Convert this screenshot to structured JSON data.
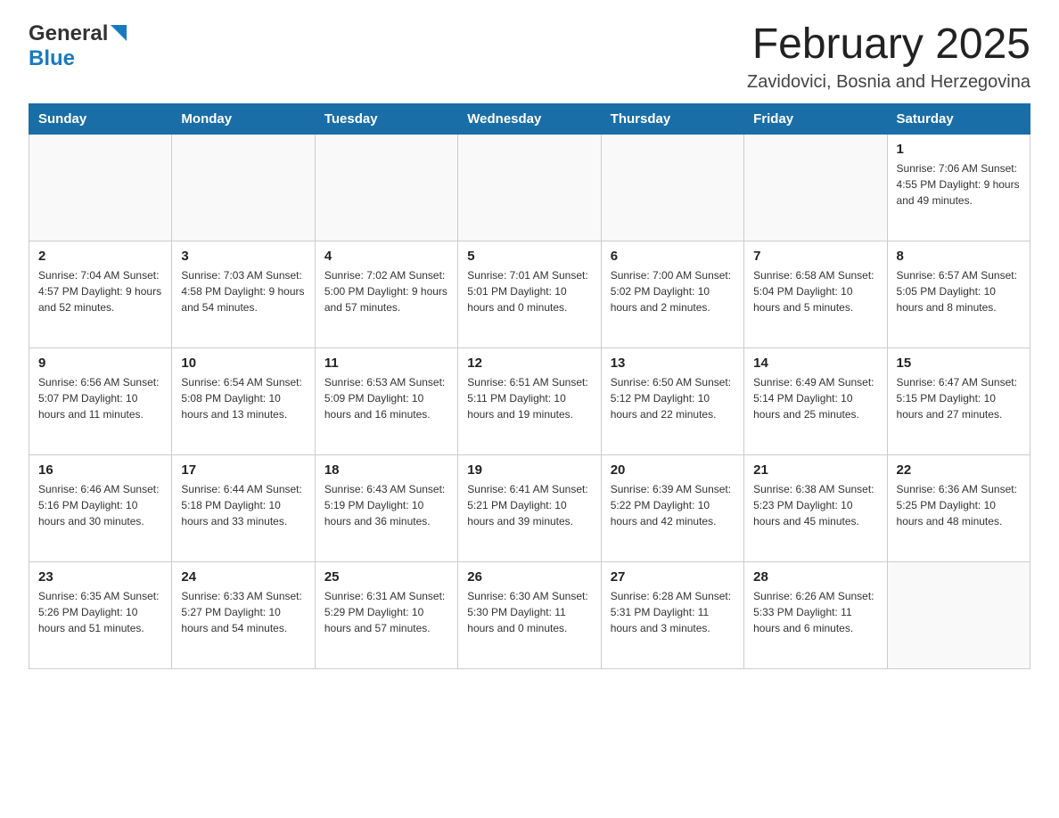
{
  "header": {
    "logo": {
      "general": "General",
      "blue": "Blue",
      "aria": "GeneralBlue logo"
    },
    "title": "February 2025",
    "subtitle": "Zavidovici, Bosnia and Herzegovina"
  },
  "weekdays": [
    "Sunday",
    "Monday",
    "Tuesday",
    "Wednesday",
    "Thursday",
    "Friday",
    "Saturday"
  ],
  "weeks": [
    [
      {
        "day": "",
        "info": ""
      },
      {
        "day": "",
        "info": ""
      },
      {
        "day": "",
        "info": ""
      },
      {
        "day": "",
        "info": ""
      },
      {
        "day": "",
        "info": ""
      },
      {
        "day": "",
        "info": ""
      },
      {
        "day": "1",
        "info": "Sunrise: 7:06 AM\nSunset: 4:55 PM\nDaylight: 9 hours and 49 minutes."
      }
    ],
    [
      {
        "day": "2",
        "info": "Sunrise: 7:04 AM\nSunset: 4:57 PM\nDaylight: 9 hours and 52 minutes."
      },
      {
        "day": "3",
        "info": "Sunrise: 7:03 AM\nSunset: 4:58 PM\nDaylight: 9 hours and 54 minutes."
      },
      {
        "day": "4",
        "info": "Sunrise: 7:02 AM\nSunset: 5:00 PM\nDaylight: 9 hours and 57 minutes."
      },
      {
        "day": "5",
        "info": "Sunrise: 7:01 AM\nSunset: 5:01 PM\nDaylight: 10 hours and 0 minutes."
      },
      {
        "day": "6",
        "info": "Sunrise: 7:00 AM\nSunset: 5:02 PM\nDaylight: 10 hours and 2 minutes."
      },
      {
        "day": "7",
        "info": "Sunrise: 6:58 AM\nSunset: 5:04 PM\nDaylight: 10 hours and 5 minutes."
      },
      {
        "day": "8",
        "info": "Sunrise: 6:57 AM\nSunset: 5:05 PM\nDaylight: 10 hours and 8 minutes."
      }
    ],
    [
      {
        "day": "9",
        "info": "Sunrise: 6:56 AM\nSunset: 5:07 PM\nDaylight: 10 hours and 11 minutes."
      },
      {
        "day": "10",
        "info": "Sunrise: 6:54 AM\nSunset: 5:08 PM\nDaylight: 10 hours and 13 minutes."
      },
      {
        "day": "11",
        "info": "Sunrise: 6:53 AM\nSunset: 5:09 PM\nDaylight: 10 hours and 16 minutes."
      },
      {
        "day": "12",
        "info": "Sunrise: 6:51 AM\nSunset: 5:11 PM\nDaylight: 10 hours and 19 minutes."
      },
      {
        "day": "13",
        "info": "Sunrise: 6:50 AM\nSunset: 5:12 PM\nDaylight: 10 hours and 22 minutes."
      },
      {
        "day": "14",
        "info": "Sunrise: 6:49 AM\nSunset: 5:14 PM\nDaylight: 10 hours and 25 minutes."
      },
      {
        "day": "15",
        "info": "Sunrise: 6:47 AM\nSunset: 5:15 PM\nDaylight: 10 hours and 27 minutes."
      }
    ],
    [
      {
        "day": "16",
        "info": "Sunrise: 6:46 AM\nSunset: 5:16 PM\nDaylight: 10 hours and 30 minutes."
      },
      {
        "day": "17",
        "info": "Sunrise: 6:44 AM\nSunset: 5:18 PM\nDaylight: 10 hours and 33 minutes."
      },
      {
        "day": "18",
        "info": "Sunrise: 6:43 AM\nSunset: 5:19 PM\nDaylight: 10 hours and 36 minutes."
      },
      {
        "day": "19",
        "info": "Sunrise: 6:41 AM\nSunset: 5:21 PM\nDaylight: 10 hours and 39 minutes."
      },
      {
        "day": "20",
        "info": "Sunrise: 6:39 AM\nSunset: 5:22 PM\nDaylight: 10 hours and 42 minutes."
      },
      {
        "day": "21",
        "info": "Sunrise: 6:38 AM\nSunset: 5:23 PM\nDaylight: 10 hours and 45 minutes."
      },
      {
        "day": "22",
        "info": "Sunrise: 6:36 AM\nSunset: 5:25 PM\nDaylight: 10 hours and 48 minutes."
      }
    ],
    [
      {
        "day": "23",
        "info": "Sunrise: 6:35 AM\nSunset: 5:26 PM\nDaylight: 10 hours and 51 minutes."
      },
      {
        "day": "24",
        "info": "Sunrise: 6:33 AM\nSunset: 5:27 PM\nDaylight: 10 hours and 54 minutes."
      },
      {
        "day": "25",
        "info": "Sunrise: 6:31 AM\nSunset: 5:29 PM\nDaylight: 10 hours and 57 minutes."
      },
      {
        "day": "26",
        "info": "Sunrise: 6:30 AM\nSunset: 5:30 PM\nDaylight: 11 hours and 0 minutes."
      },
      {
        "day": "27",
        "info": "Sunrise: 6:28 AM\nSunset: 5:31 PM\nDaylight: 11 hours and 3 minutes."
      },
      {
        "day": "28",
        "info": "Sunrise: 6:26 AM\nSunset: 5:33 PM\nDaylight: 11 hours and 6 minutes."
      },
      {
        "day": "",
        "info": ""
      }
    ]
  ]
}
